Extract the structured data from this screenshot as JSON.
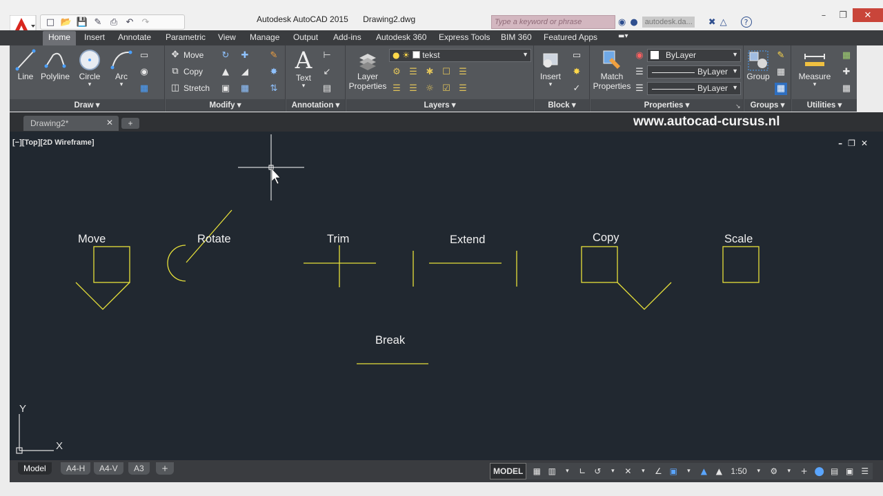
{
  "window": {
    "app_title": "Autodesk AutoCAD 2015",
    "doc_title": "Drawing2.dwg",
    "search_placeholder": "Type a keyword or phrase",
    "signin": "autodesk.da..."
  },
  "ribbon_tabs": [
    "Home",
    "Insert",
    "Annotate",
    "Parametric",
    "View",
    "Manage",
    "Output",
    "Add-ins",
    "Autodesk 360",
    "Express Tools",
    "BIM 360",
    "Featured Apps"
  ],
  "panels": {
    "draw": {
      "title": "Draw",
      "tools": [
        "Line",
        "Polyline",
        "Circle",
        "Arc"
      ]
    },
    "modify": {
      "title": "Modify",
      "tools": [
        "Move",
        "Copy",
        "Stretch"
      ]
    },
    "annotation": {
      "title": "Annotation",
      "tools": [
        "Text"
      ]
    },
    "layers": {
      "title": "Layers",
      "tool": "Layer",
      "tool2": "Properties",
      "current_layer": "tekst"
    },
    "block": {
      "title": "Block",
      "tool": "Insert"
    },
    "properties": {
      "title": "Properties",
      "tool": "Match",
      "tool2": "Properties",
      "color": "ByLayer",
      "linetype": "ByLayer",
      "lineweight": "ByLayer"
    },
    "groups": {
      "title": "Groups",
      "tool": "Group"
    },
    "utilities": {
      "title": "Utilities",
      "tool": "Measure"
    }
  },
  "file_tab": {
    "name": "Drawing2*"
  },
  "watermark": "www.autocad-cursus.nl",
  "viewport": {
    "label": "[−][Top][2D Wireframe]"
  },
  "commands": [
    "Move",
    "Rotate",
    "Trim",
    "Extend",
    "Copy",
    "Scale",
    "Break"
  ],
  "ucs": {
    "x": "X",
    "y": "Y"
  },
  "layout_tabs": [
    "Model",
    "A4-H",
    "A4-V",
    "A3"
  ],
  "status": {
    "model": "MODEL",
    "scale": "1:50"
  },
  "colors": {
    "geometry": "#e8e23a",
    "background": "#212830",
    "crosshair": "#ffffff"
  }
}
